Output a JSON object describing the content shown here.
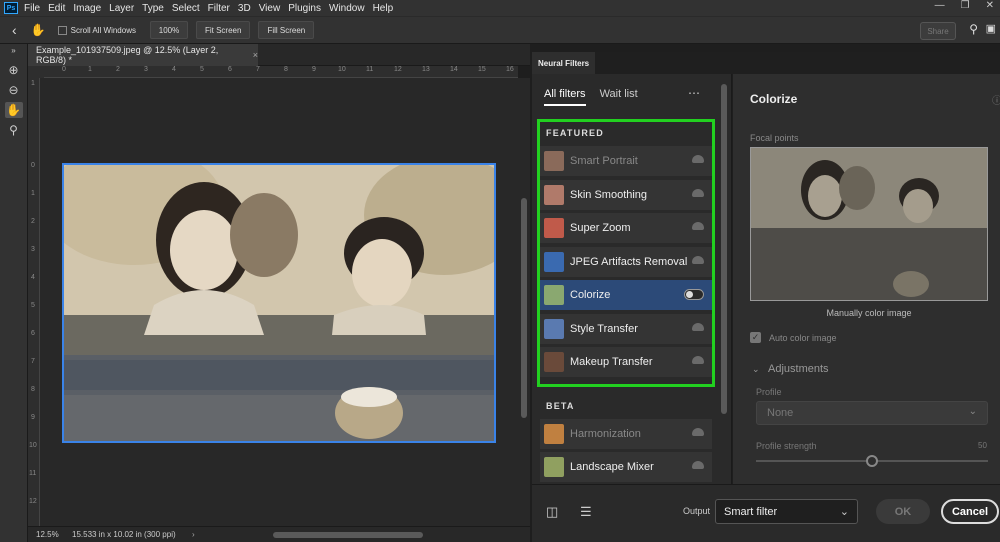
{
  "menubar": {
    "logo": "Ps",
    "items": [
      "File",
      "Edit",
      "Image",
      "Layer",
      "Type",
      "Select",
      "Filter",
      "3D",
      "View",
      "Plugins",
      "Window",
      "Help"
    ]
  },
  "options": {
    "scroll_all_windows": "Scroll All Windows",
    "zoom_100": "100%",
    "fit_screen": "Fit Screen",
    "fill_screen": "Fill Screen",
    "share": "Share"
  },
  "document": {
    "tab_title": "Example_101937509.jpeg @ 12.5% (Layer 2, RGB/8) *",
    "zoom": "12.5%",
    "doc_info": "15.533 in x 10.02 in (300 ppi)"
  },
  "neural_filters": {
    "panel_title": "Neural Filters",
    "tabs": [
      "All filters",
      "Wait list"
    ],
    "featured_label": "FEATURED",
    "beta_label": "BETA",
    "featured": [
      {
        "label": "Smart Portrait",
        "dim": true,
        "thumb_color": "#8a6a5a"
      },
      {
        "label": "Skin Smoothing",
        "dim": false,
        "thumb_color": "#b07a6a"
      },
      {
        "label": "Super Zoom",
        "dim": false,
        "thumb_color": "#c05a4a"
      },
      {
        "label": "JPEG Artifacts Removal",
        "dim": false,
        "thumb_color": "#3a6ab0"
      },
      {
        "label": "Colorize",
        "dim": false,
        "thumb_color": "#8aa870"
      },
      {
        "label": "Style Transfer",
        "dim": false,
        "thumb_color": "#5a7ab0"
      },
      {
        "label": "Makeup Transfer",
        "dim": false,
        "thumb_color": "#6a4a3a"
      }
    ],
    "beta": [
      {
        "label": "Harmonization",
        "dim": true,
        "thumb_color": "#c08040"
      },
      {
        "label": "Landscape Mixer",
        "dim": false,
        "thumb_color": "#90a060"
      }
    ]
  },
  "colorize": {
    "title": "Colorize",
    "focal_points": "Focal points",
    "manual": "Manually color image",
    "auto": "Auto color image",
    "adjustments": "Adjustments",
    "profile_label": "Profile",
    "profile_value": "None",
    "strength_label": "Profile strength",
    "strength_value": "50",
    "strength_fraction": 0.5
  },
  "footer": {
    "output_label": "Output",
    "output_value": "Smart filter",
    "ok": "OK",
    "cancel": "Cancel"
  }
}
